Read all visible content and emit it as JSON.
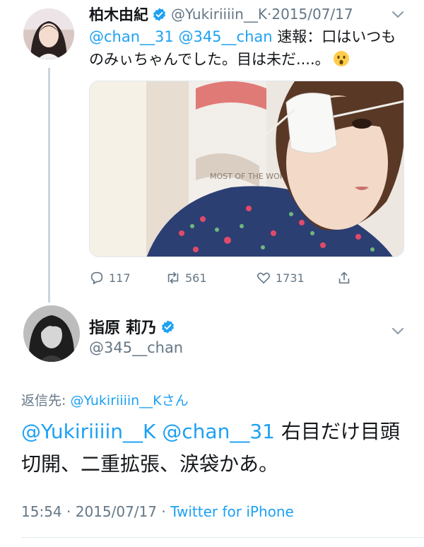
{
  "tweet1": {
    "display_name": "柏木由紀",
    "handle": "@Yukiriiiin__K",
    "date": "2015/07/17",
    "text_mention1": "@chan__31",
    "text_mention2": "@345__chan",
    "text_body": " 速報：口はいつものみぃちゃんでした。目は未だ....。",
    "emoji": "hushed-face",
    "photo_caption_fragment": "MOST OF THE WORLD",
    "reply_count": "117",
    "retweet_count": "561",
    "like_count": "1731",
    "icons": [
      "reply-icon",
      "retweet-icon",
      "like-icon",
      "share-icon",
      "verified-badge-icon",
      "chevron-down-icon"
    ]
  },
  "tweet2": {
    "display_name": "指原 莉乃",
    "handle": "@345__chan",
    "reply_to_label": "返信先: ",
    "reply_to_handle": "@Yukiriiiin__K",
    "reply_to_suffix": "さん",
    "text_mention1": "@Yukiriiiin__K",
    "text_mention2": "@chan__31",
    "text_body": " 右目だけ目頭切開、二重拡張、涙袋かあ。",
    "time": "15:54",
    "date": "2015/07/17",
    "source": "Twitter for iPhone"
  },
  "colors": {
    "link": "#1da1f2",
    "secondary_text": "#657786",
    "primary_text": "#14171a",
    "thread_line": "#ccd6dd"
  }
}
